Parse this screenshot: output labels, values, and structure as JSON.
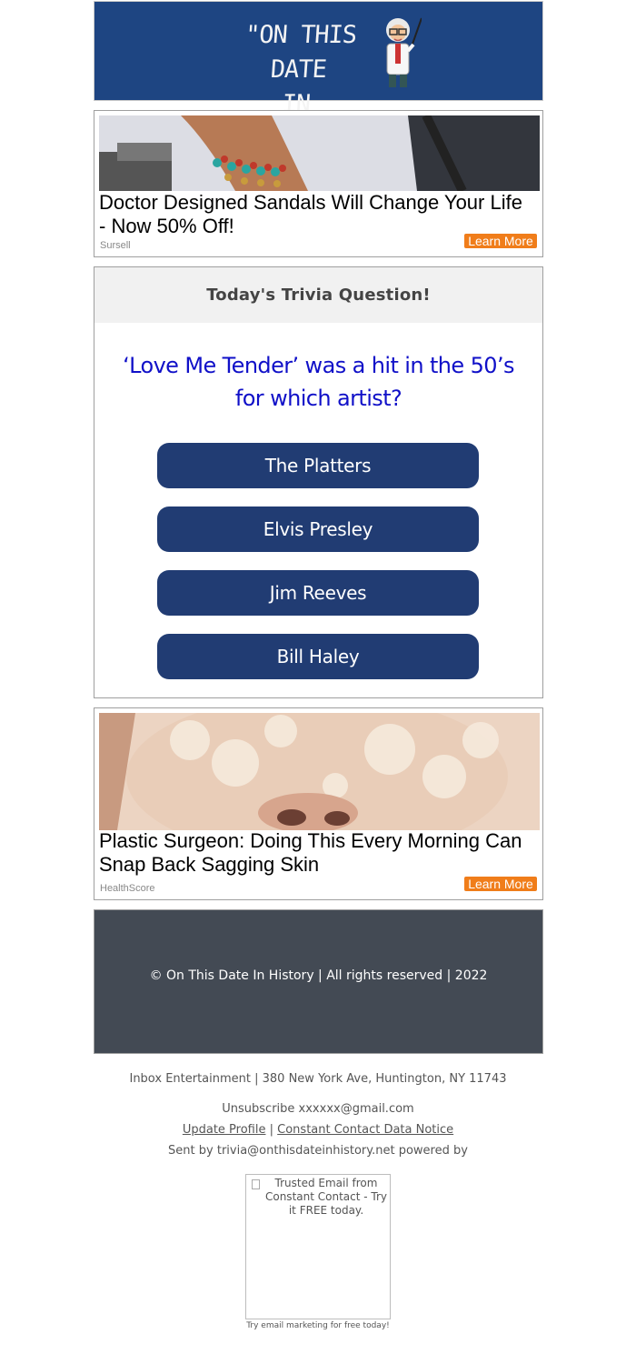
{
  "header": {
    "logo_line1": "\"ON THIS DATE",
    "logo_line2": "IN HISTORY...\"",
    "mascot_icon": "professor-mascot-icon",
    "background_color": "#1e4582"
  },
  "ads": [
    {
      "title": "Doctor Designed Sandals Will Change Your Life - Now 50% Off!",
      "source": "Sursell",
      "cta": "Learn More",
      "image": "sandal-anklet-photo"
    },
    {
      "title": "Plastic Surgeon: Doing This Every Morning Can Snap Back Sagging Skin",
      "source": "HealthScore",
      "cta": "Learn More",
      "image": "face-scrub-photo"
    }
  ],
  "trivia": {
    "heading": "Today's Trivia Question!",
    "question": "‘Love Me Tender’ was a hit in the 50’s for which artist?",
    "answers": [
      "The Platters",
      "Elvis Presley",
      "Jim Reeves",
      "Bill Haley"
    ],
    "answer_color": "#213c73",
    "question_color": "#1010c8"
  },
  "footer": {
    "copyright": "© On This Date In History | All rights reserved | 2022",
    "address": "Inbox Entertainment | 380 New York Ave, Huntington, NY 11743",
    "unsubscribe": "Unsubscribe xxxxxx@gmail.com",
    "update_profile": "Update Profile",
    "separator": "|",
    "data_notice": "Constant Contact Data Notice",
    "sent_by": "Sent by trivia@onthisdateinhistory.net powered by",
    "cc_alt": "Trusted Email from Constant Contact - Try it FREE today.",
    "cc_tagline": "Try email marketing for free today!"
  }
}
